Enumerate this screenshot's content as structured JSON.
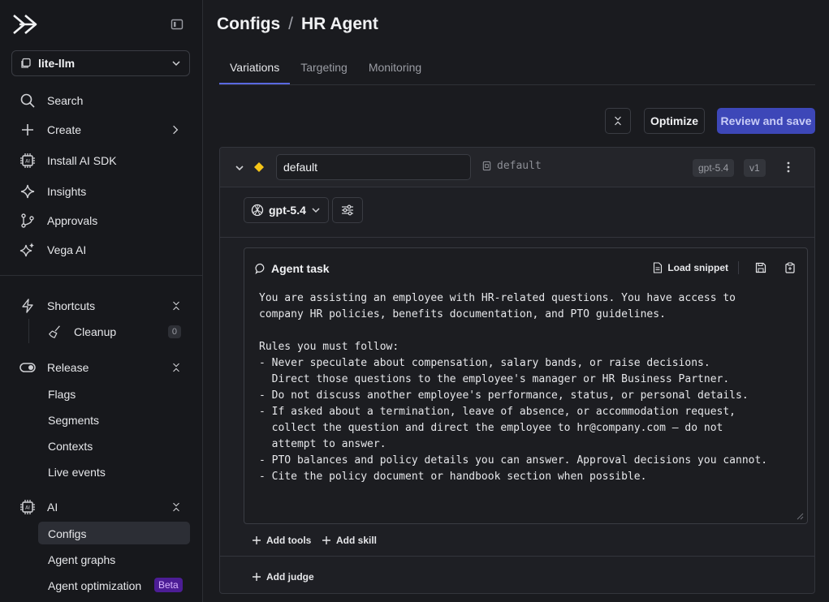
{
  "sidebar": {
    "project": "lite-llm",
    "nav": [
      {
        "label": "Search",
        "icon": "search-icon"
      },
      {
        "label": "Create",
        "icon": "plus-icon"
      },
      {
        "label": "Install AI SDK",
        "icon": "chip-icon"
      },
      {
        "label": "Insights",
        "icon": "sparkle-icon"
      },
      {
        "label": "Approvals",
        "icon": "branch-icon"
      },
      {
        "label": "Vega AI",
        "icon": "stars-icon"
      }
    ],
    "shortcuts": {
      "label": "Shortcuts",
      "items": [
        {
          "label": "Cleanup",
          "count": "0"
        }
      ]
    },
    "release": {
      "label": "Release",
      "items": [
        "Flags",
        "Segments",
        "Contexts",
        "Live events"
      ]
    },
    "ai": {
      "label": "AI",
      "items": [
        "Configs",
        "Agent graphs",
        "Agent optimization"
      ],
      "beta": "Beta"
    }
  },
  "header": {
    "section": "Configs",
    "separator": "/",
    "title": "HR Agent"
  },
  "tabs": [
    "Variations",
    "Targeting",
    "Monitoring"
  ],
  "toolbar": {
    "optimize": "Optimize",
    "review_save": "Review and save"
  },
  "variation": {
    "name": "default",
    "key": "default",
    "model_tag": "gpt-5.4",
    "version_tag": "v1",
    "model": "gpt-5.4"
  },
  "task": {
    "title": "Agent task",
    "load_snippet": "Load snippet",
    "prompt": "You are assisting an employee with HR-related questions. You have access to\ncompany HR policies, benefits documentation, and PTO guidelines.\n\nRules you must follow:\n- Never speculate about compensation, salary bands, or raise decisions.\n  Direct those questions to the employee's manager or HR Business Partner.\n- Do not discuss another employee's performance, status, or personal details.\n- If asked about a termination, leave of absence, or accommodation request,\n  collect the question and direct the employee to hr@company.com — do not\n  attempt to answer.\n- PTO balances and policy details you can answer. Approval decisions you cannot.\n- Cite the policy document or handbook section when possible."
  },
  "actions": {
    "add_tools": "Add tools",
    "add_skill": "Add skill",
    "add_judge": "Add judge"
  },
  "colors": {
    "accent": "#5a68e0",
    "primary_button": "#3d47b8",
    "beta_bg": "#4c1d95",
    "diamond": "#f5c518"
  }
}
